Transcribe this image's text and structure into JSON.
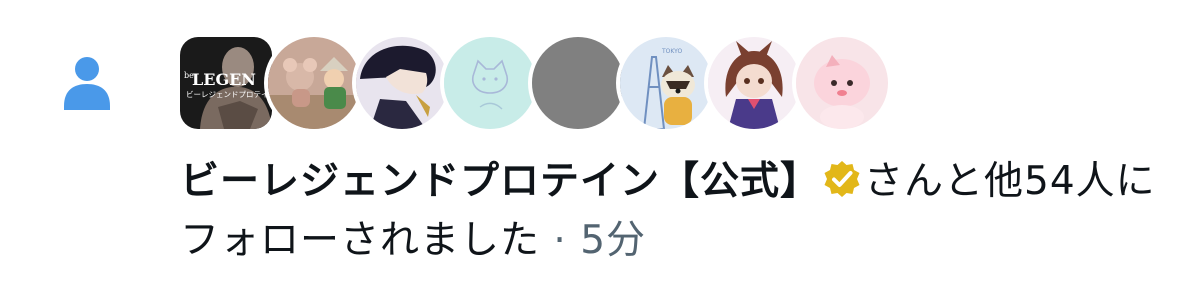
{
  "notification": {
    "type_icon": "person-follow-icon",
    "avatars": [
      {
        "icon": "avatar-be-legend",
        "label": "LEGEN",
        "sub_label": "ビーレジェンドプロテイン",
        "brand_prefix": "be"
      },
      {
        "icon": "avatar-figures",
        "label": ""
      },
      {
        "icon": "avatar-anime-boy",
        "label": ""
      },
      {
        "icon": "avatar-cat-sketch",
        "label": ""
      },
      {
        "icon": "avatar-default-gray",
        "label": ""
      },
      {
        "icon": "avatar-raccoon-tower",
        "label": "TOKYO"
      },
      {
        "icon": "avatar-horse-girl",
        "label": ""
      },
      {
        "icon": "avatar-pink-character",
        "label": ""
      }
    ],
    "user_name": "ビーレジェンドプロテイン【公式】",
    "verified_icon": "verified-badge-icon",
    "message_suffix": "さんと他54人に",
    "message_line2": "フォローされました",
    "separator": "·",
    "timestamp": "5分",
    "colors": {
      "accent_blue": "#4a99e9",
      "verified_gold": "#e2b719",
      "text_primary": "#0f1419",
      "text_secondary": "#536471"
    }
  }
}
